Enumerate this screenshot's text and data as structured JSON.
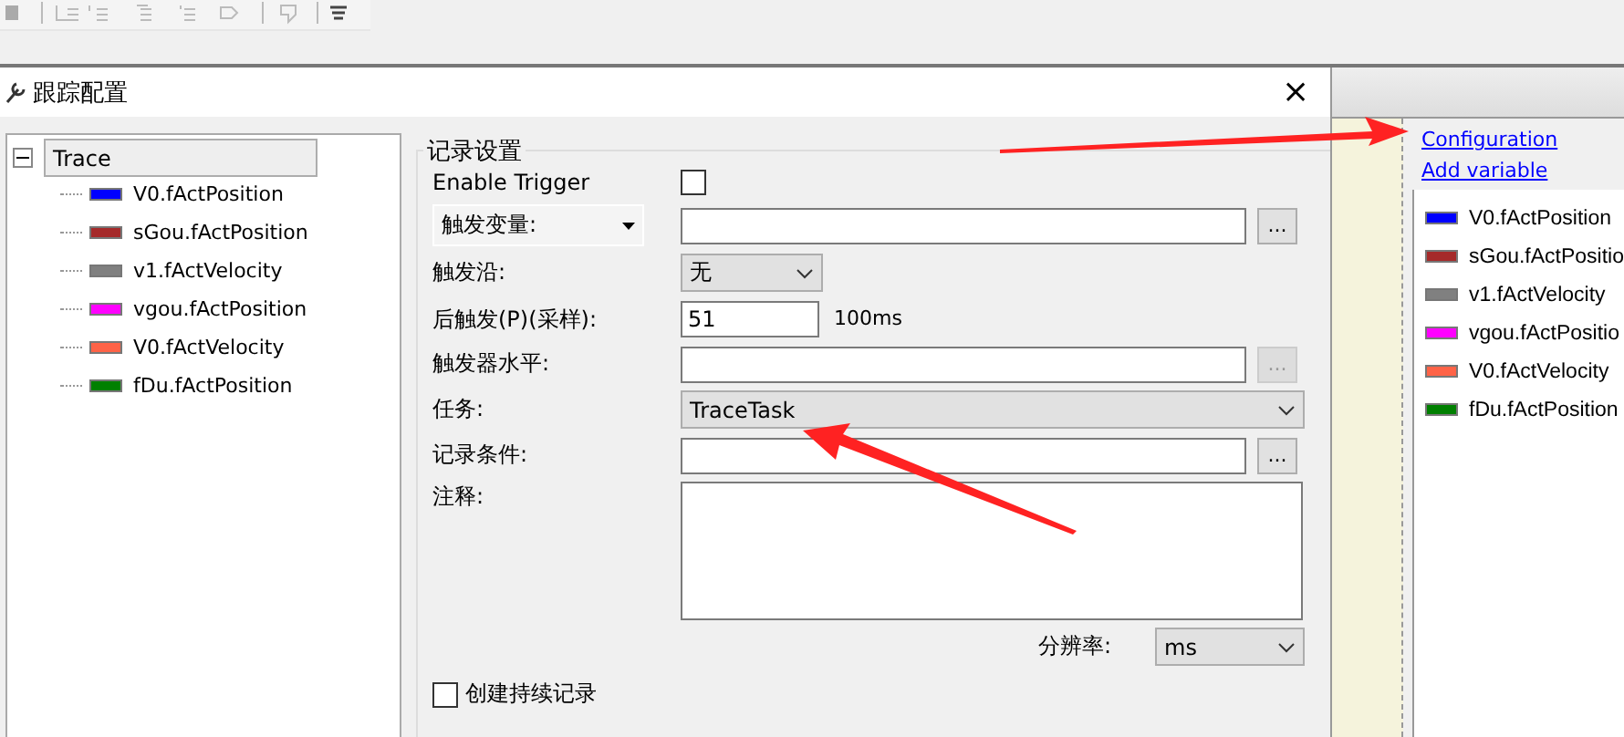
{
  "dialog": {
    "title": "跟踪配置",
    "close": "×"
  },
  "tree": {
    "label": "Trace",
    "expanded": true,
    "selected": true,
    "children": [
      {
        "name": "V0.fActPosition",
        "color": "#0000ff"
      },
      {
        "name": "sGou.fActPosition",
        "color": "#a52a2a"
      },
      {
        "name": "v1.fActVelocity",
        "color": "#808080"
      },
      {
        "name": "vgou.fActPosition",
        "color": "#ff00ff"
      },
      {
        "name": "V0.fActVelocity",
        "color": "#ff6347"
      },
      {
        "name": "fDu.fActPosition",
        "color": "#008000"
      }
    ]
  },
  "settings": {
    "group_title": "记录设置",
    "enable_trigger": {
      "label": "Enable Trigger",
      "checked": false
    },
    "trigger_variable": {
      "label": "触发变量:",
      "browse": "...",
      "browse_disabled": false
    },
    "trigger_edge": {
      "label": "触发沿:",
      "value": "无"
    },
    "post_trigger": {
      "label": "后触发(P)(采样):",
      "value": "51",
      "unit": "100ms"
    },
    "trigger_level": {
      "label": "触发器水平:",
      "browse": "...",
      "browse_disabled": true
    },
    "task": {
      "label": "任务:",
      "value": "TraceTask"
    },
    "record_condition": {
      "label": "记录条件:",
      "browse": "...",
      "browse_disabled": false
    },
    "comment": {
      "label": "注释:"
    },
    "resolution": {
      "label": "分辨率:",
      "value": "ms"
    },
    "persistent": {
      "label": "创建持续记录",
      "checked": false
    }
  },
  "side": {
    "links": [
      "Configuration",
      "Add variable"
    ],
    "legend": [
      {
        "name": "V0.fActPosition",
        "color": "#0000ff"
      },
      {
        "name": "sGou.fActPositio",
        "color": "#a52a2a"
      },
      {
        "name": "v1.fActVelocity",
        "color": "#808080"
      },
      {
        "name": "vgou.fActPositio",
        "color": "#ff00ff"
      },
      {
        "name": "V0.fActVelocity",
        "color": "#ff6347"
      },
      {
        "name": "fDu.fActPosition",
        "color": "#008000"
      }
    ]
  }
}
